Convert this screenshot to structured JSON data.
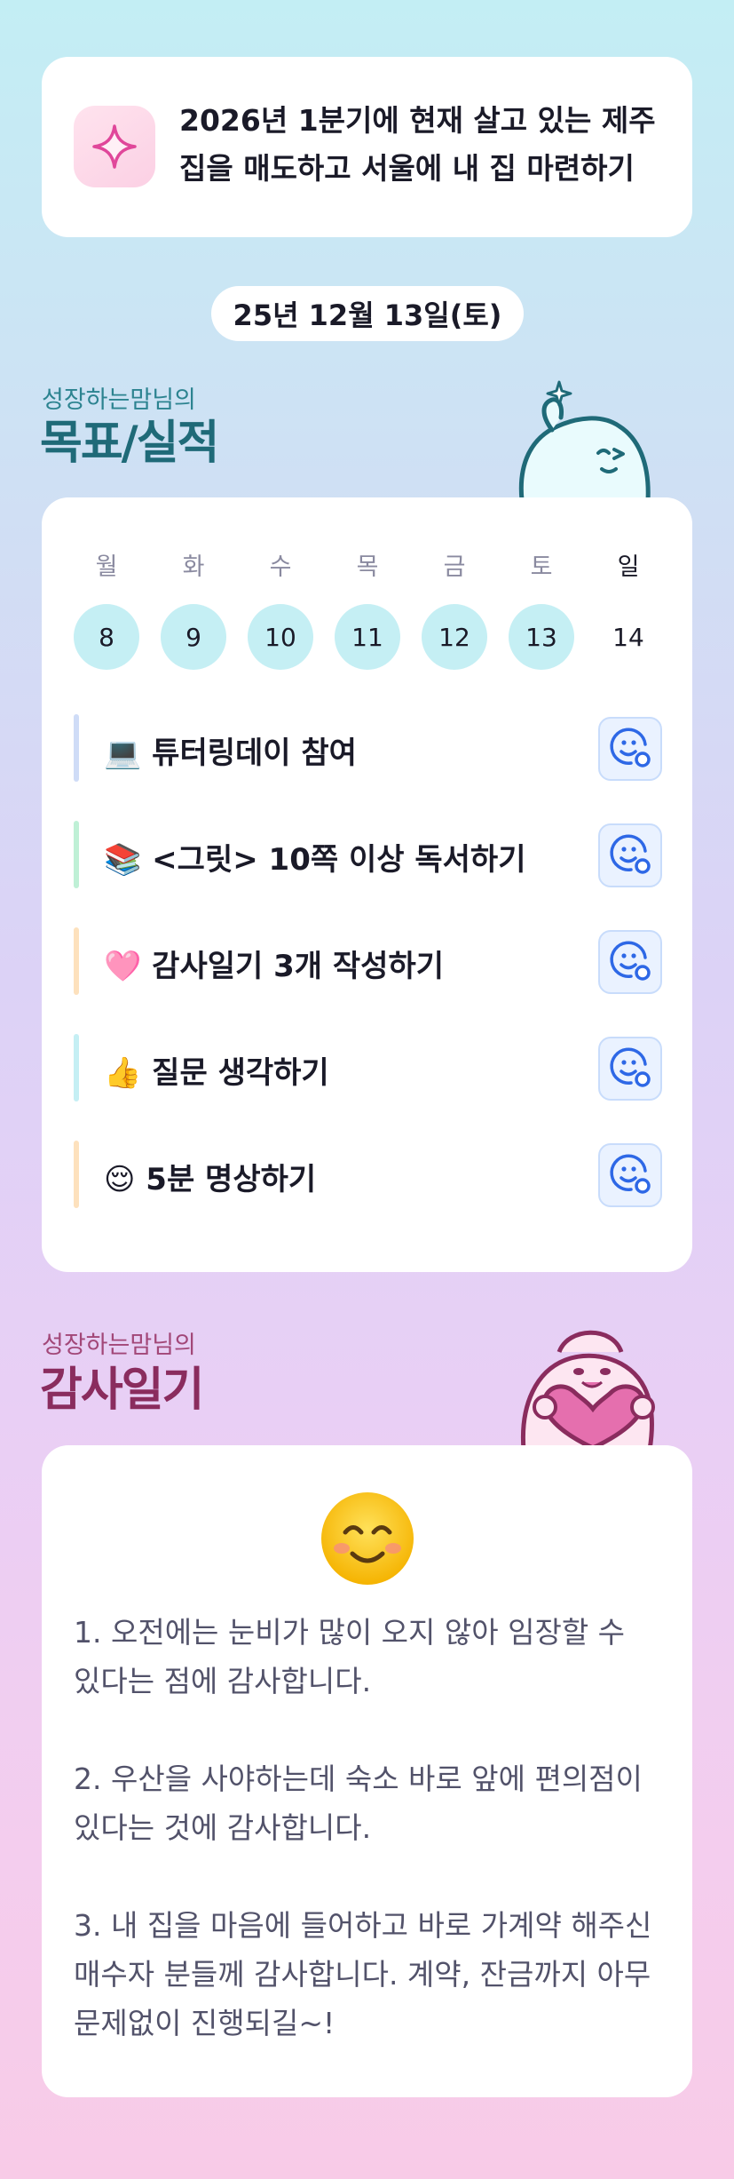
{
  "goal": {
    "icon": "sparkle-icon",
    "text": "2026년 1분기에 현재 살고 있는 제주 집을 매도하고 서울에 내 집 마련하기"
  },
  "date": "25년 12월 13일(토)",
  "goals_section": {
    "subtitle": "성장하는맘님의",
    "title": "목표/실적",
    "week": [
      {
        "label": "월",
        "day": "8",
        "done": true
      },
      {
        "label": "화",
        "day": "9",
        "done": true
      },
      {
        "label": "수",
        "day": "10",
        "done": true
      },
      {
        "label": "목",
        "day": "11",
        "done": true
      },
      {
        "label": "금",
        "day": "12",
        "done": true
      },
      {
        "label": "토",
        "day": "13",
        "done": true
      },
      {
        "label": "일",
        "day": "14",
        "done": false
      }
    ],
    "tasks": [
      {
        "label": "💻 튜터링데이 참여",
        "color": "#cfdcf7"
      },
      {
        "label": "📚 <그릿> 10쪽 이상 독서하기",
        "color": "#bff0d6"
      },
      {
        "label": "🩷 감사일기 3개 작성하기",
        "color": "#fde1bd"
      },
      {
        "label": "👍 질문 생각하기",
        "color": "#c5eff4"
      },
      {
        "label": "😌 5분 명상하기",
        "color": "#fde1bd"
      }
    ],
    "task_button_icon": "smiley-status-icon",
    "accent": "#2e68e6"
  },
  "gratitude_section": {
    "subtitle": "성장하는맘님의",
    "title": "감사일기",
    "mood_icon": "smiling-face-icon",
    "items": [
      "1. 오전에는 눈비가 많이 오지 않아 임장할 수 있다는 점에 감사합니다.",
      "2. 우산을 사야하는데 숙소 바로 앞에 편의점이 있다는 것에 감사합니다.",
      "3. 내 집을 마음에 들어하고 바로 가계약 해주신 매수자 분들께 감사합니다. 계약, 잔금까지 아무 문제없이 진행되길~!"
    ]
  }
}
